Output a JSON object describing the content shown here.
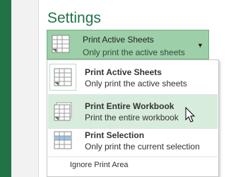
{
  "settings": {
    "title": "Settings",
    "selector": {
      "label": "Print Active Sheets",
      "sublabel": "Only print the active sheets"
    },
    "menu": {
      "items": [
        {
          "label": "Print Active Sheets",
          "description": "Only print the active sheets"
        },
        {
          "label": "Print Entire Workbook",
          "description": "Print the entire workbook"
        },
        {
          "label": "Print Selection",
          "description": "Only print the current selection"
        }
      ],
      "ignore_print_area": "Ignore Print Area"
    }
  },
  "colors": {
    "accent": "#217346",
    "selector_bg": "#9dcfa8",
    "highlight_bg": "#d7ecdc"
  }
}
